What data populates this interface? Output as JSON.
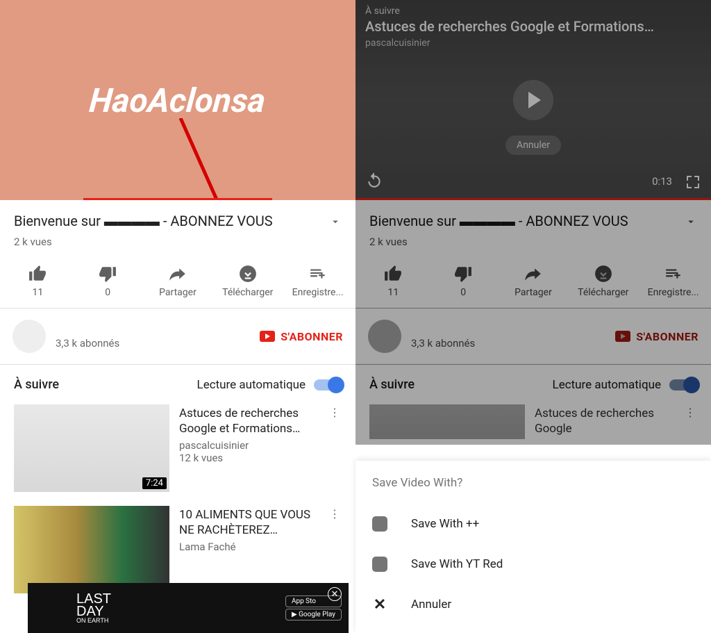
{
  "left": {
    "video_title": "Bienvenue sur ▬▬▬▬ - ABONNEZ VOUS",
    "views": "2 k vues",
    "actions": {
      "like": "11",
      "dislike": "0",
      "share": "Partager",
      "download": "Télécharger",
      "save": "Enregistre..."
    },
    "channel": {
      "name": "",
      "subs": "3,3 k abonnés",
      "subscribe": "S'ABONNER"
    },
    "autoplay": {
      "heading": "À suivre",
      "label": "Lecture automatique"
    },
    "next_videos": [
      {
        "title": "Astuces de recherches Google et Formations…",
        "channel": "pascalcuisinier",
        "views": "12 k vues",
        "duration": "7:24"
      },
      {
        "title": "10 ALIMENTS QUE VOUS NE RACHÈTEREZ…",
        "channel": "Lama Faché",
        "views": "",
        "duration": ""
      }
    ],
    "ad": {
      "logo_l1": "LAST",
      "logo_l2": "DAY",
      "logo_l3": "ON EARTH",
      "store1": "App Sto",
      "store2": "Google Play"
    }
  },
  "right": {
    "overlay": {
      "next_label": "À suivre",
      "title": "Astuces de recherches Google et Formations…",
      "channel": "pascalcuisinier",
      "cancel": "Annuler",
      "time": "0:13"
    },
    "video_title": "Bienvenue sur ▬▬▬▬ - ABONNEZ VOUS",
    "views": "2 k vues",
    "actions": {
      "like": "11",
      "dislike": "0",
      "share": "Partager",
      "download": "Télécharger",
      "save": "Enregistre..."
    },
    "channel": {
      "name": "",
      "subs": "3,3 k abonnés",
      "subscribe": "S'ABONNER"
    },
    "autoplay": {
      "heading": "À suivre",
      "label": "Lecture automatique"
    },
    "next_videos": [
      {
        "title": "Astuces de recherches Google",
        "channel": "",
        "views": "",
        "duration": ""
      }
    ],
    "sheet": {
      "title": "Save Video With?",
      "opt1": "Save With ++",
      "opt2": "Save With YT Red",
      "cancel": "Annuler"
    }
  }
}
